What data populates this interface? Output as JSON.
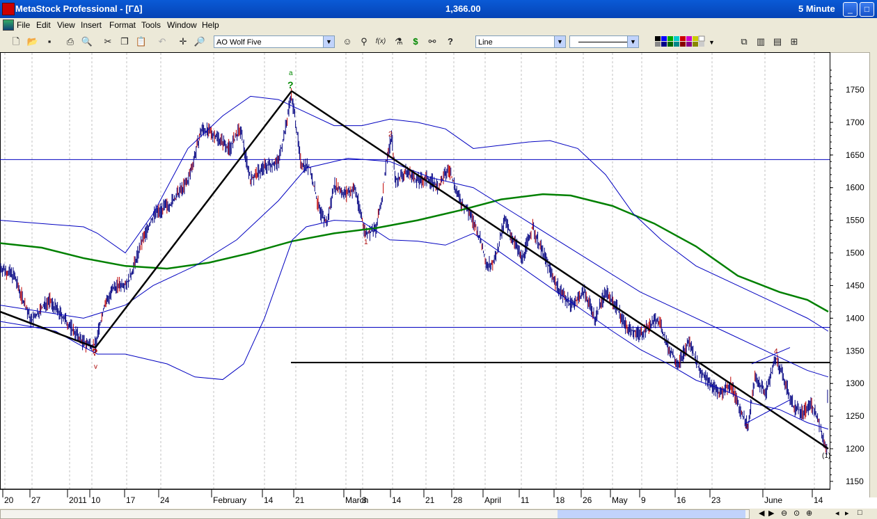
{
  "window": {
    "title": "MetaStock Professional - [Γ∆]",
    "price": "1,366.00",
    "interval": "5 Minute"
  },
  "menu": [
    "File",
    "Edit",
    "View",
    "Insert",
    "Format",
    "Tools",
    "Window",
    "Help"
  ],
  "toolbar": {
    "expert": "AO Wolf Five",
    "style": "Line"
  },
  "colors": {
    "price": "#000080",
    "bands": "#0000c0",
    "ma": "#008000",
    "trend": "#000000",
    "up_bar": "#c00000",
    "grid": "#c0c0c0"
  },
  "chart_data": {
    "type": "line",
    "y_ticks": [
      "1750",
      "1700",
      "1650",
      "1600",
      "1550",
      "1500",
      "1450",
      "1400",
      "1350",
      "1300",
      "1250",
      "1200",
      "1150"
    ],
    "x_labels": [
      "20",
      "27",
      "2011",
      "10",
      "17",
      "24",
      "February",
      "14",
      "21",
      "March",
      "8",
      "14",
      "21",
      "28",
      "April",
      "11",
      "18",
      "26",
      "May",
      "9",
      "16",
      "23",
      "June",
      "14"
    ],
    "ylim": [
      1150,
      1780
    ],
    "hlines": [
      1643,
      1386
    ],
    "support_line": 1332,
    "wave_labels": [
      "a",
      "?",
      "2",
      "1",
      "v",
      "?",
      "4",
      "3",
      "(1)"
    ],
    "trendlines": [
      {
        "x0": 0,
        "y0": 1410,
        "x1": 10,
        "y1": 1355
      },
      {
        "x0": 10,
        "y0": 1355,
        "x1": 21,
        "y1": 1748
      },
      {
        "x0": 21,
        "y0": 1748,
        "x1": 60,
        "y1": 1200
      }
    ]
  }
}
